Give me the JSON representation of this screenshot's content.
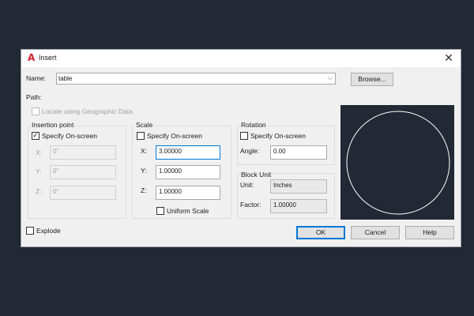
{
  "dialog": {
    "title": "Insert",
    "app_icon": "autocad-logo-icon",
    "close_icon": "close-icon"
  },
  "name": {
    "label": "Name:",
    "value": "table",
    "browse_label": "Browse..."
  },
  "path": {
    "label": "Path:"
  },
  "geo": {
    "label": "Locate using Geographic Data",
    "checked": false
  },
  "insertion": {
    "title": "Insertion point",
    "specify_label": "Specify On-screen",
    "specify_checked": true,
    "x_label": "X:",
    "x_value": "0\"",
    "y_label": "Y:",
    "y_value": "0\"",
    "z_label": "Z:",
    "z_value": "0\""
  },
  "scale": {
    "title": "Scale",
    "specify_label": "Specify On-screen",
    "specify_checked": false,
    "x_label": "X:",
    "x_value": "3.00000",
    "y_label": "Y:",
    "y_value": "1.00000",
    "z_label": "Z:",
    "z_value": "1.00000",
    "uniform_label": "Uniform Scale",
    "uniform_checked": false
  },
  "rotation": {
    "title": "Rotation",
    "specify_label": "Specify On-screen",
    "specify_checked": false,
    "angle_label": "Angle:",
    "angle_value": "0.00"
  },
  "block_unit": {
    "title": "Block Unit",
    "unit_label": "Unit:",
    "unit_value": "Inches",
    "factor_label": "Factor:",
    "factor_value": "1.00000"
  },
  "explode": {
    "label": "Explode",
    "checked": false
  },
  "buttons": {
    "ok": "OK",
    "cancel": "Cancel",
    "help": "Help"
  },
  "colors": {
    "preview_bg": "#222834",
    "accent": "#0078d7",
    "icon_red": "#d11f2a"
  }
}
